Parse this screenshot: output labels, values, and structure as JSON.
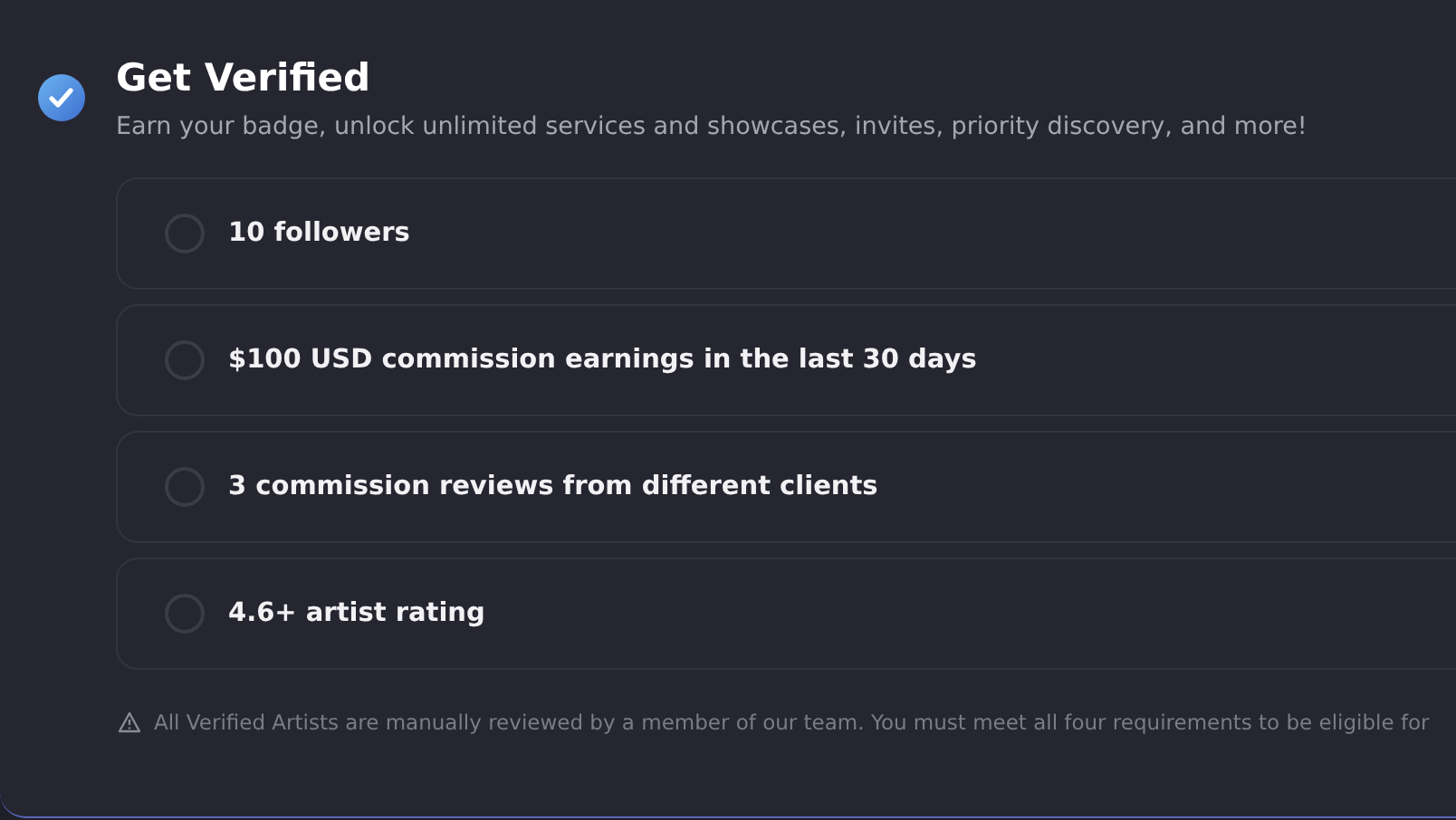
{
  "header": {
    "title": "Get Verified",
    "subtitle": "Earn your badge, unlock unlimited services and showcases, invites, priority discovery, and more!"
  },
  "requirements": [
    {
      "label": "10 followers",
      "checked": false
    },
    {
      "label": "$100 USD commission earnings in the last 30 days",
      "checked": false
    },
    {
      "label": "3 commission reviews from different clients",
      "checked": false
    },
    {
      "label": "4.6+ artist rating",
      "checked": false
    }
  ],
  "footnote": "All Verified Artists are manually reviewed by a member of our team. You must meet all four requirements to be eligible for"
}
